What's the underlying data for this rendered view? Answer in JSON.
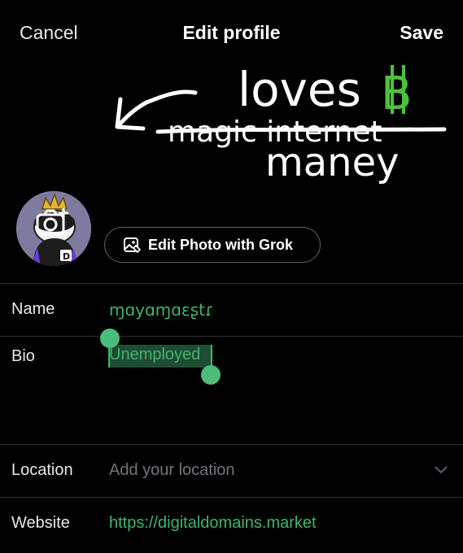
{
  "header": {
    "cancel": "Cancel",
    "title": "Edit profile",
    "save": "Save"
  },
  "banner": {
    "line1": "loves",
    "strikethrough": "magic internet",
    "line3": "maney",
    "symbol": "B",
    "symbol_color": "#4cc23b"
  },
  "photo": {
    "grok_button": "Edit Photo with Grok"
  },
  "fields": {
    "name": {
      "label": "Name",
      "value": "ɱɑyɑɱɑεʂtɾ"
    },
    "bio": {
      "label": "Bio",
      "value": "Unemployed"
    },
    "location": {
      "label": "Location",
      "placeholder": "Add your location"
    },
    "website": {
      "label": "Website",
      "value": "https://digitaldomains.market"
    }
  },
  "colors": {
    "accent": "#3fb56d",
    "muted": "#71767b",
    "divider": "#2f3336"
  }
}
